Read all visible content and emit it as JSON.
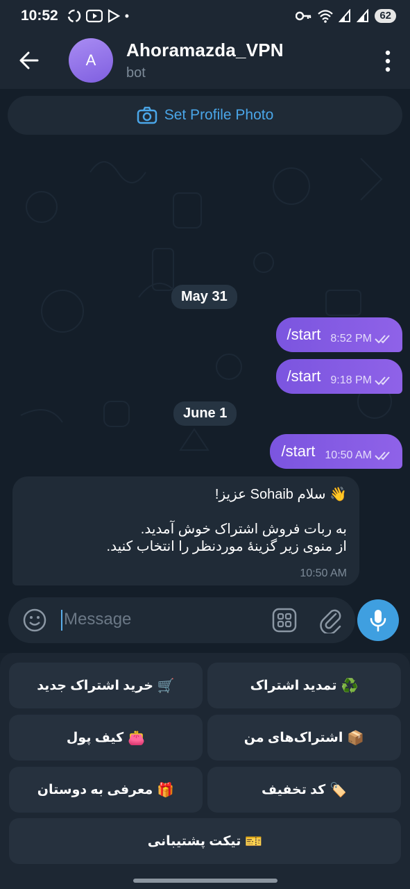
{
  "status": {
    "time": "10:52",
    "battery": "62"
  },
  "header": {
    "avatar_letter": "A",
    "title": "Ahoramazda_VPN",
    "subtitle": "bot"
  },
  "chat": {
    "set_profile_photo": "Set Profile Photo",
    "date1": "May 31",
    "date2": "June 1",
    "messages_out": [
      {
        "text": "/start",
        "time": "8:52 PM"
      },
      {
        "text": "/start",
        "time": "9:18 PM"
      },
      {
        "text": "/start",
        "time": "10:50 AM"
      }
    ],
    "message_in": {
      "line1": "سلام Sohaib عزیز!",
      "wave": "👋",
      "line2": "به ربات فروش اشتراک خوش آمدید.",
      "line3": "از منوی زیر گزینهٔ موردنظر را انتخاب کنید.",
      "time": "10:50 AM"
    }
  },
  "input": {
    "placeholder": "Message"
  },
  "keyboard": {
    "buttons": [
      {
        "label": "تمدید اشتراک",
        "emoji": "♻️"
      },
      {
        "label": "خرید اشتراک جدید",
        "emoji": "🛒"
      },
      {
        "label": "اشتراک‌های من",
        "emoji": "📦"
      },
      {
        "label": "کیف پول",
        "emoji": "👛"
      },
      {
        "label": "کد تخفیف",
        "emoji": "🏷️"
      },
      {
        "label": "معرفی به دوستان",
        "emoji": "🎁"
      },
      {
        "label": "تیکت پشتیبانی",
        "emoji": "🎫"
      }
    ]
  },
  "colors": {
    "accent": "#4aa6e8",
    "outgoing": "#8459e3",
    "background": "#141e29"
  }
}
